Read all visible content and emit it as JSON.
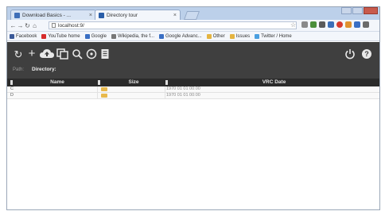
{
  "browser": {
    "tabs": [
      {
        "title": "Download Basics - ..."
      },
      {
        "title": "Directory tour"
      }
    ],
    "address": "localhost:9/",
    "bookmarks": [
      {
        "label": "Facebook",
        "color": "#3b5998"
      },
      {
        "label": "YouTube home",
        "color": "#d62b2b"
      },
      {
        "label": "Google",
        "color": "#3a6fc4"
      },
      {
        "label": "Wikipedia, the f...",
        "color": "#777777"
      },
      {
        "label": "Google Advanc...",
        "color": "#3a6fc4"
      },
      {
        "label": "Other",
        "color": "#e4b441"
      },
      {
        "label": "Issues",
        "color": "#e4b441"
      },
      {
        "label": "Twitter / Home",
        "color": "#4a9fe0"
      }
    ]
  },
  "toolbar": {
    "icons": [
      "refresh-icon",
      "plus-icon",
      "cloud-upload-icon",
      "copy-icon",
      "search-icon",
      "info-icon",
      "document-icon",
      "power-icon",
      "help-icon"
    ],
    "path_label": "Path:",
    "path_value": "Directory:"
  },
  "table": {
    "columns": [
      {
        "label": "Name"
      },
      {
        "label": "Size"
      },
      {
        "label": "VRC Date"
      }
    ],
    "rows": [
      {
        "name": "C",
        "size_icon": "folder-icon",
        "date": "1970 01 01 00:00"
      },
      {
        "name": "D",
        "size_icon": "folder-icon",
        "date": "1970 01 01 00:00"
      }
    ]
  },
  "colors": {
    "app_toolbar": "#3f3f3f",
    "table_header": "#2b2b2b",
    "folder": "#e8b94d",
    "tabstrip": "#bcd0ea"
  }
}
